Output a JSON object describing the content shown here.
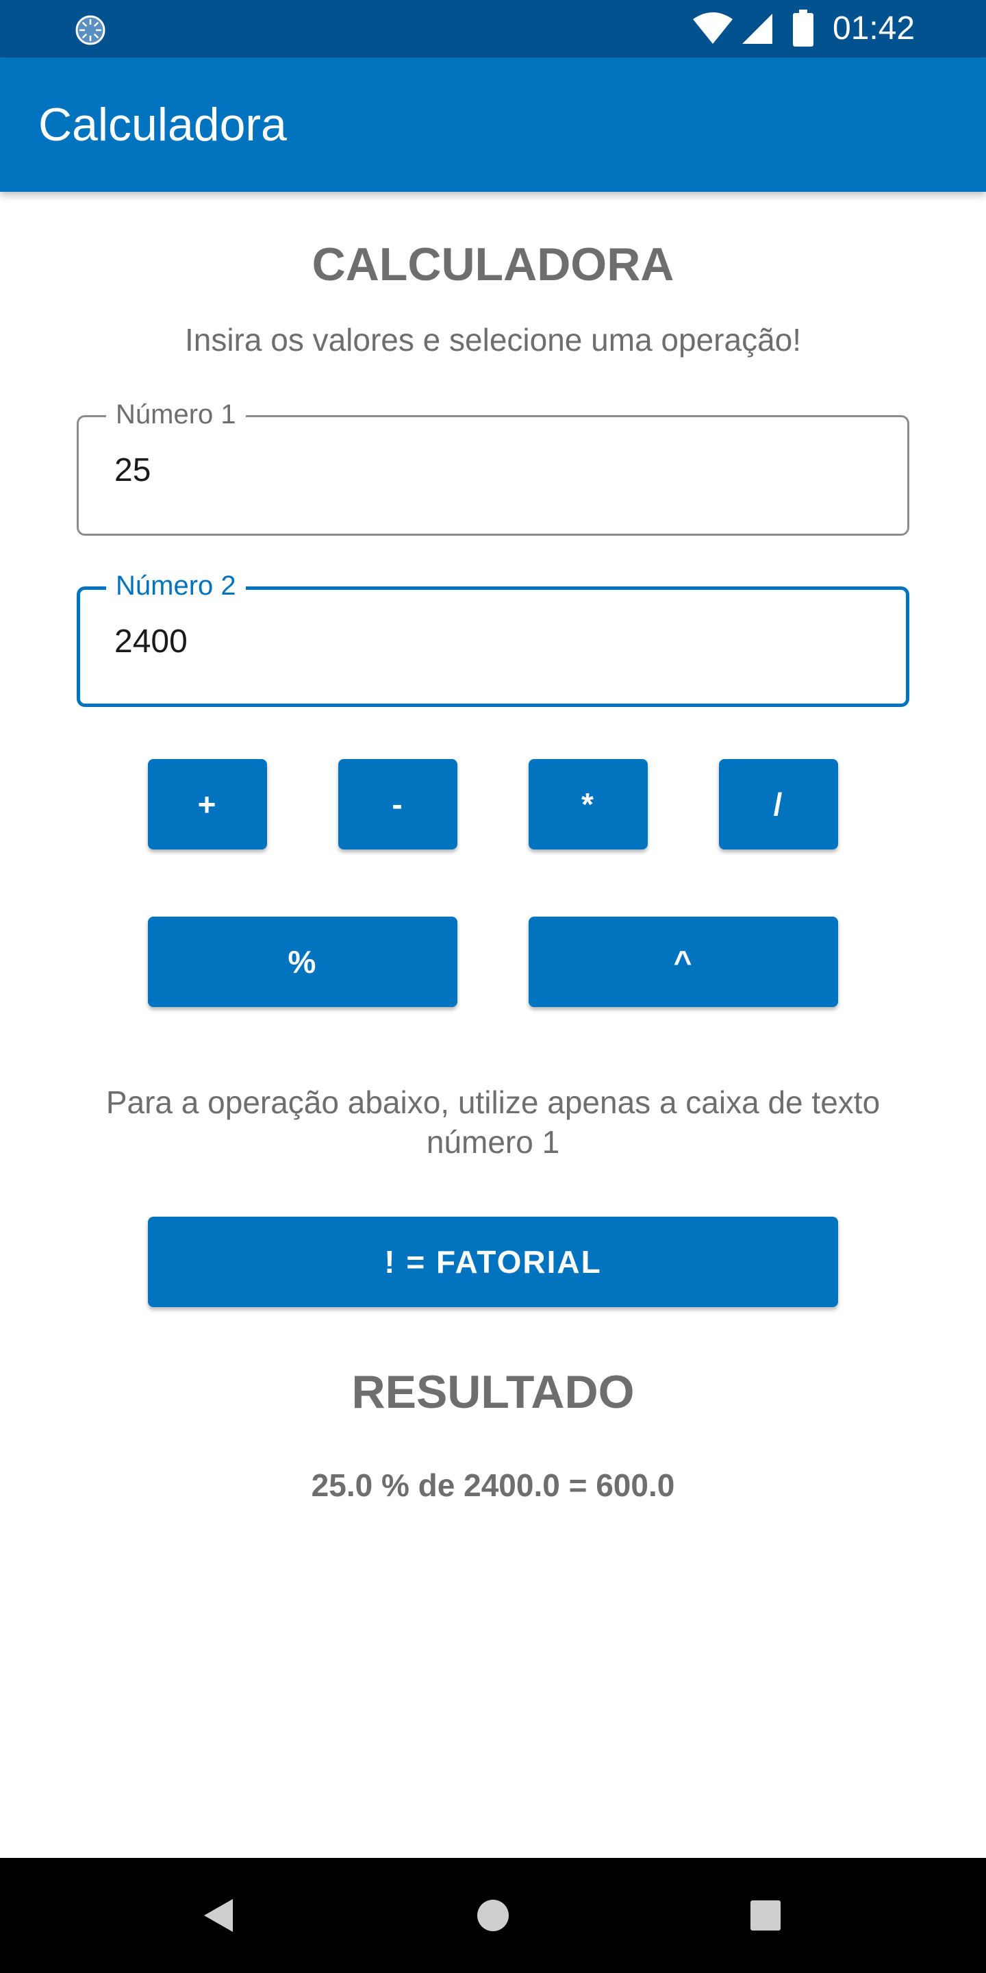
{
  "status_bar": {
    "time": "01:42",
    "icons": [
      "loading-icon",
      "wifi-icon",
      "signal-icon",
      "battery-icon"
    ]
  },
  "app_bar": {
    "title": "Calculadora"
  },
  "main": {
    "heading": "CALCULADORA",
    "subheading": "Insira os valores e selecione uma operação!",
    "fields": {
      "numero1": {
        "label": "Número 1",
        "value": "25"
      },
      "numero2": {
        "label": "Número 2",
        "value": "2400",
        "focused": true
      }
    },
    "operations": {
      "add": "+",
      "subtract": "-",
      "multiply": "*",
      "divide": "/",
      "percent": "%",
      "power": "^"
    },
    "note": "Para a operação abaixo, utilize apenas a caixa de texto número 1",
    "factorial_label": "! = FATORIAL",
    "result_heading": "RESULTADO",
    "result_text": "25.0 % de 2400.0 = 600.0"
  },
  "nav_bar": {
    "icons": [
      "back-icon",
      "home-icon",
      "recent-apps-icon"
    ]
  },
  "colors": {
    "status_bar": "#02528f",
    "primary": "#0274bf",
    "text_secondary": "#6e6e6e",
    "field_border": "#8c8c8c",
    "nav_bar": "#000000"
  }
}
